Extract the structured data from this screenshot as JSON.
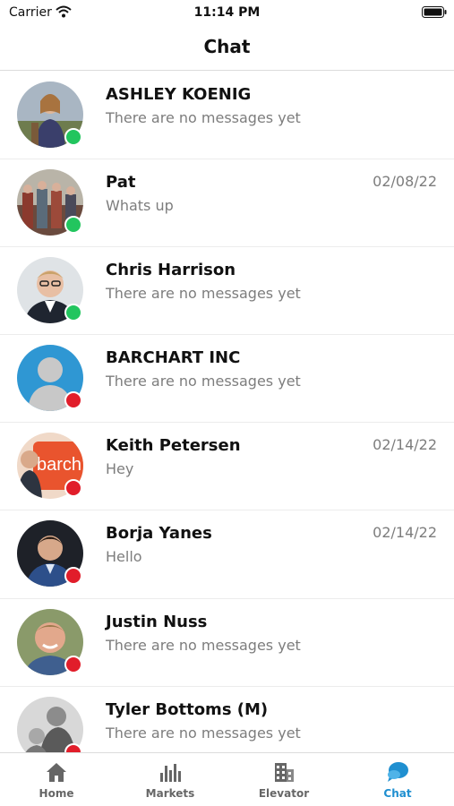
{
  "status_bar": {
    "carrier": "Carrier",
    "time": "11:14 PM"
  },
  "header": {
    "title": "Chat"
  },
  "colors": {
    "online": "#22c55e",
    "offline": "#e11d2a",
    "accent": "#1f8fd0"
  },
  "chats": [
    {
      "name": "ASHLEY KOENIG",
      "preview": "There are no messages yet",
      "date": "",
      "status": "online"
    },
    {
      "name": "Pat",
      "preview": "Whats up",
      "date": "02/08/22",
      "status": "online"
    },
    {
      "name": "Chris Harrison",
      "preview": "There are no messages yet",
      "date": "",
      "status": "online"
    },
    {
      "name": "BARCHART INC",
      "preview": "There are no messages yet",
      "date": "",
      "status": "offline"
    },
    {
      "name": "Keith Petersen",
      "preview": "Hey",
      "date": "02/14/22",
      "status": "offline"
    },
    {
      "name": "Borja Yanes",
      "preview": "Hello",
      "date": "02/14/22",
      "status": "offline"
    },
    {
      "name": "Justin Nuss",
      "preview": "There are no messages yet",
      "date": "",
      "status": "offline"
    },
    {
      "name": "Tyler Bottoms (M)",
      "preview": "There are no messages yet",
      "date": "",
      "status": "offline"
    }
  ],
  "tabs": [
    {
      "label": "Home",
      "icon": "home-icon",
      "active": false
    },
    {
      "label": "Markets",
      "icon": "bar-chart-icon",
      "active": false
    },
    {
      "label": "Elevator",
      "icon": "building-icon",
      "active": false
    },
    {
      "label": "Chat",
      "icon": "chat-bubble-icon",
      "active": true
    }
  ]
}
